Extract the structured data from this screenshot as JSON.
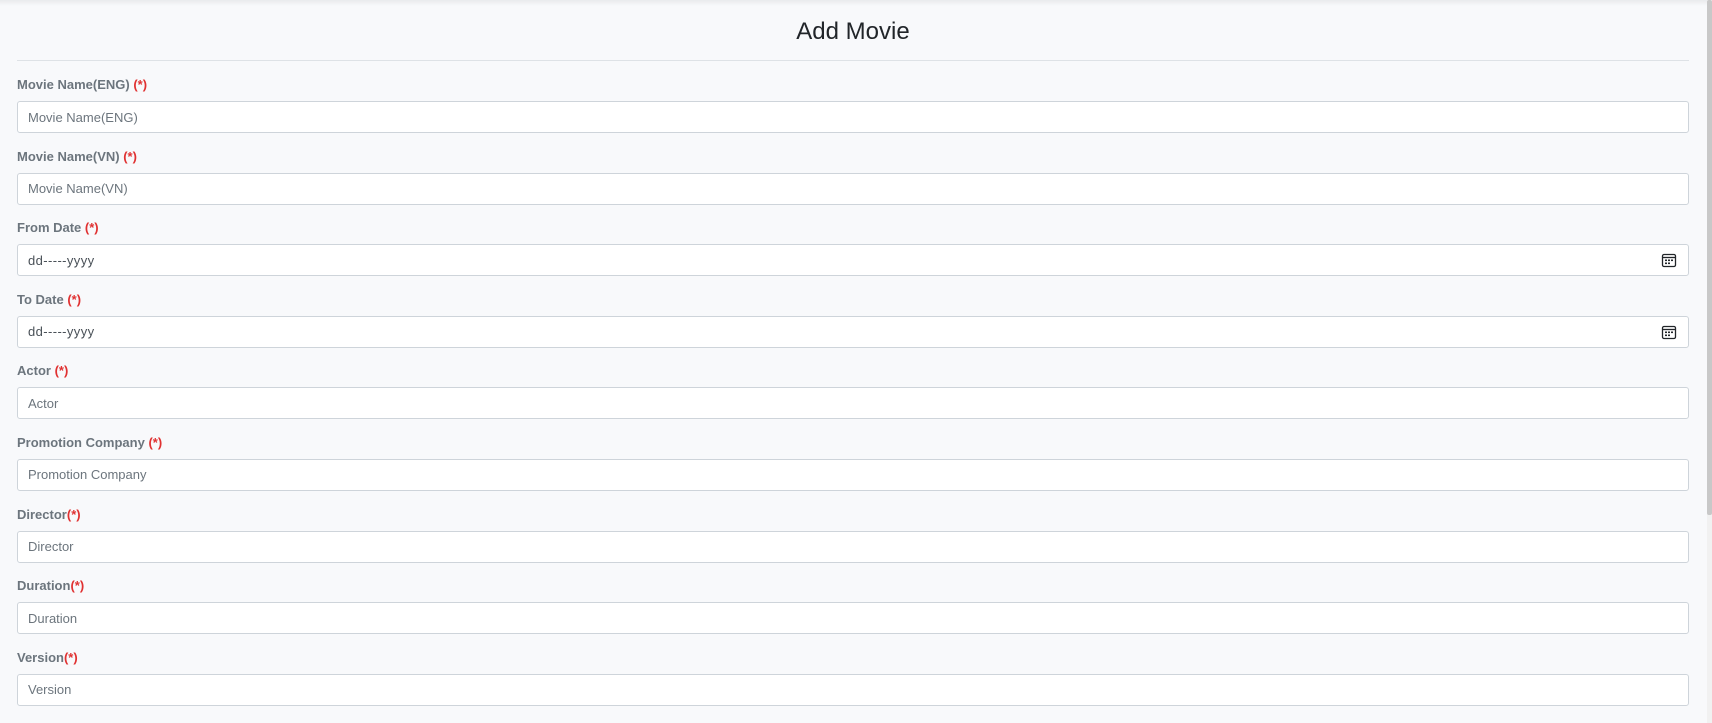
{
  "page": {
    "title": "Add Movie"
  },
  "required_mark": "(*)",
  "fields": [
    {
      "label": "Movie Name(ENG)",
      "mark": " (*)",
      "placeholder": "Movie Name(ENG)",
      "type": "text"
    },
    {
      "label": "Movie Name(VN)",
      "mark": " (*)",
      "placeholder": "Movie Name(VN)",
      "type": "text"
    },
    {
      "label": "From Date",
      "mark": " (*)",
      "placeholder": "dd-----yyyy",
      "type": "date"
    },
    {
      "label": "To Date",
      "mark": " (*)",
      "placeholder": "dd-----yyyy",
      "type": "date"
    },
    {
      "label": "Actor",
      "mark": " (*)",
      "placeholder": "Actor",
      "type": "text"
    },
    {
      "label": "Promotion Company",
      "mark": " (*)",
      "placeholder": "Promotion Company",
      "type": "text"
    },
    {
      "label": "Director",
      "mark": "(*)",
      "placeholder": "Director",
      "type": "text"
    },
    {
      "label": "Duration",
      "mark": "(*)",
      "placeholder": "Duration",
      "type": "text"
    },
    {
      "label": "Version",
      "mark": "(*)",
      "placeholder": "Version",
      "type": "text"
    }
  ],
  "icons": {
    "date_picker": "calendar-icon"
  },
  "colors": {
    "required": "#e03131",
    "label": "#6c757d",
    "background": "#f8f9fb"
  }
}
